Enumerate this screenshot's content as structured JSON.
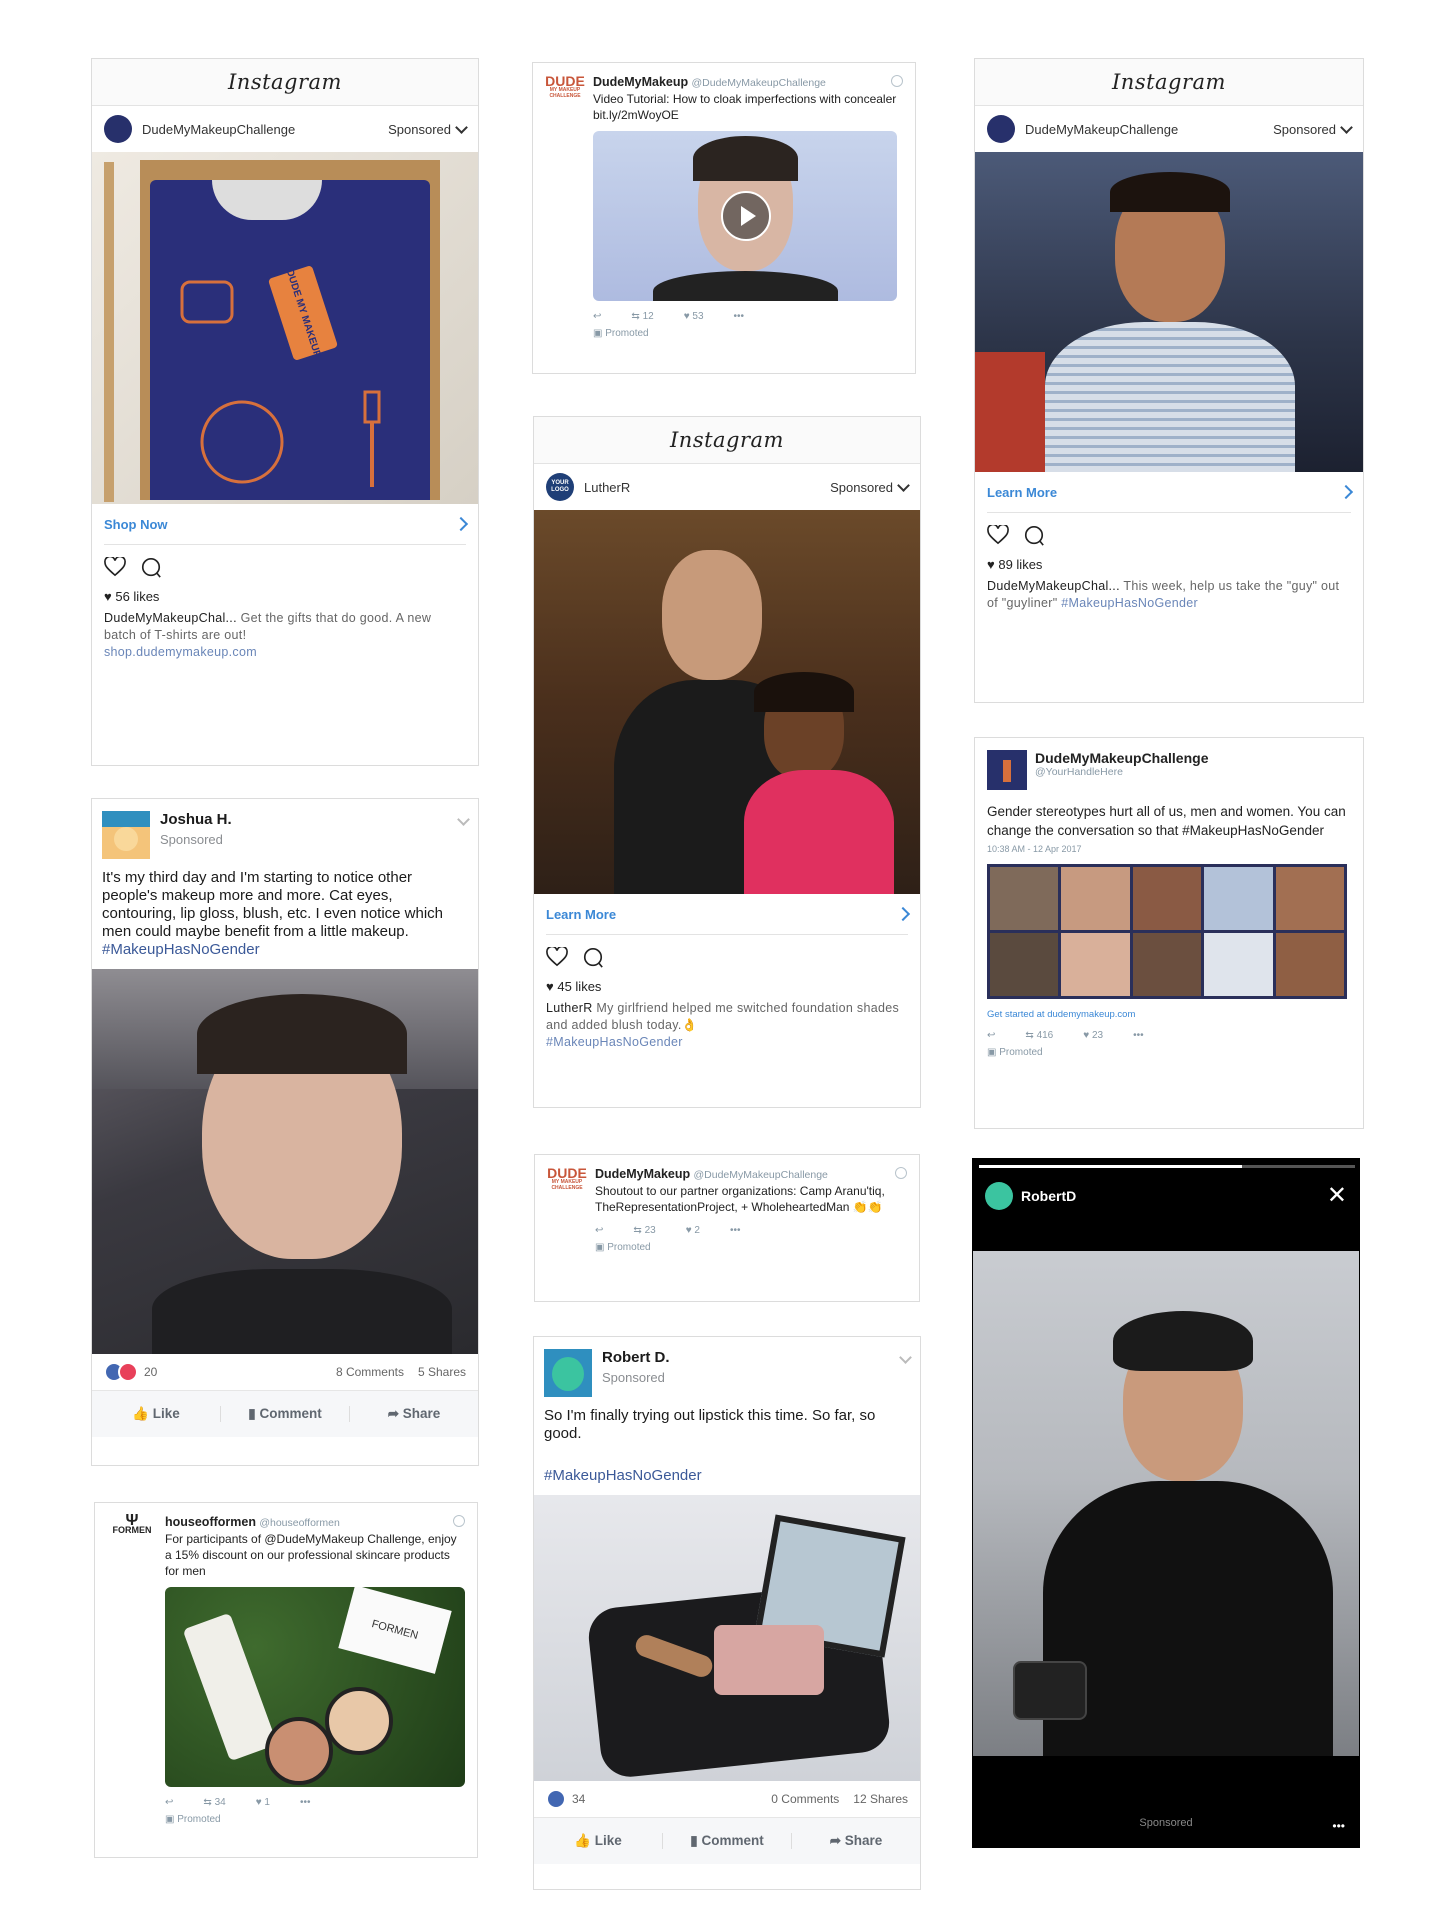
{
  "ig_card1": {
    "brand": "Instagram",
    "account": "DudeMyMakeupChallenge",
    "sponsored": "Sponsored",
    "cta": "Shop Now",
    "likes": "56 likes",
    "caption_user": "DudeMyMakeupChal...",
    "caption_text": "Get the gifts that do good. A new batch of T-shirts are out!",
    "caption_link": "shop.dudemymakeup.com",
    "tag_text": "DUDE MY MAKEUP"
  },
  "tw_card1": {
    "logo": "DUDE",
    "logo_sub": "MY MAKEUP CHALLENGE",
    "name": "DudeMyMakeup",
    "handle": "@DudeMyMakeupChallenge",
    "text": "Video Tutorial: How to cloak imperfections with concealer bit.ly/2mWoyOE",
    "retweets": "12",
    "likes": "53",
    "promoted": "Promoted"
  },
  "ig_card2": {
    "brand": "Instagram",
    "account": "DudeMyMakeupChallenge",
    "sponsored": "Sponsored",
    "cta": "Learn More",
    "likes": "89 likes",
    "caption_user": "DudeMyMakeupChal...",
    "caption_text": "This week, help us take the \"guy\" out of \"guyliner\"",
    "caption_tag": "#MakeupHasNoGender"
  },
  "ig_card3": {
    "brand": "Instagram",
    "avatar_text": "YOUR LOGO",
    "account": "LutherR",
    "sponsored": "Sponsored",
    "cta": "Learn More",
    "likes": "45 likes",
    "caption_user": "LutherR",
    "caption_text": "My girlfriend helped me switched foundation shades and added blush today.👌",
    "caption_tag": "#MakeupHasNoGender"
  },
  "fb_card1": {
    "name": "Joshua H.",
    "sponsored": "Sponsored",
    "text": "It's my third day and I'm starting to notice other people's makeup more and more. Cat eyes, contouring, lip gloss, blush, etc. I even notice which men could maybe benefit from a little makeup.",
    "tag": "#MakeupHasNoGender",
    "reactions": "20",
    "comments": "8 Comments",
    "shares": "5 Shares",
    "like": "Like",
    "comment": "Comment",
    "share": "Share"
  },
  "tw_card2": {
    "name": "DudeMyMakeupChallenge",
    "handle": "@YourHandleHere",
    "text": "Gender stereotypes hurt all of us, men and women. You can change the conversation so that #MakeupHasNoGender",
    "time": "10:38 AM - 12 Apr 2017",
    "link": "Get started at dudemymakeup.com",
    "retweets": "416",
    "likes": "23",
    "promoted": "Promoted"
  },
  "tw_card3": {
    "logo": "DUDE",
    "logo_sub": "MY MAKEUP CHALLENGE",
    "name": "DudeMyMakeup",
    "handle": "@DudeMyMakeupChallenge",
    "text": "Shoutout to our partner organizations: Camp Aranu'tiq, TheRepresentationProject, + WholeheartedMan 👏👏",
    "retweets": "23",
    "likes": "2",
    "promoted": "Promoted"
  },
  "fb_card2": {
    "name": "Robert D.",
    "sponsored": "Sponsored",
    "text": "So I'm finally trying out lipstick this time. So far, so good.",
    "tag": "#MakeupHasNoGender",
    "reactions": "34",
    "comments": "0 Comments",
    "shares": "12 Shares",
    "like": "Like",
    "comment": "Comment",
    "share": "Share"
  },
  "tw_card4": {
    "logo_sub": "FORMEN",
    "name": "houseofformen",
    "handle": "@houseofformen",
    "text": "For participants of @DudeMyMakeup Challenge, enjoy a 15% discount on our professional skincare products for men",
    "product_label": "FORMEN",
    "retweets": "34",
    "likes": "1",
    "promoted": "Promoted"
  },
  "story_card": {
    "account": "RobertD",
    "sponsored": "Sponsored",
    "progress": 0.7
  },
  "colors": {
    "ig_link": "#3b88d6",
    "fb_link": "#3b5998",
    "tw_gray": "#8899a6",
    "brand_orange": "#c8563a",
    "shirt_navy": "#2a2f7a"
  }
}
